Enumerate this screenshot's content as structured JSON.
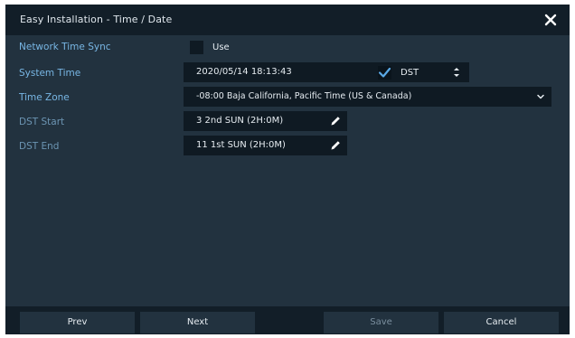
{
  "window": {
    "title": "Easy Installation - Time / Date"
  },
  "fields": {
    "network_time_sync": {
      "label": "Network Time Sync",
      "checkbox_label": "Use",
      "checked": false
    },
    "system_time": {
      "label": "System Time",
      "value": "2020/05/14 18:13:43",
      "dst_label": "DST",
      "dst_checked": true
    },
    "time_zone": {
      "label": "Time Zone",
      "value": "-08:00 Baja California, Pacific Time (US & Canada)"
    },
    "dst_start": {
      "label": "DST Start",
      "value": "3 2nd SUN (2H:0M)"
    },
    "dst_end": {
      "label": "DST End",
      "value": "11 1st SUN (2H:0M)"
    }
  },
  "footer": {
    "prev_label": "Prev",
    "next_label": "Next",
    "save_label": "Save",
    "cancel_label": "Cancel"
  },
  "icons": {
    "close": "close-icon",
    "check": "check-icon",
    "spinner": "spinner-arrows-icon",
    "dropdown": "chevron-down-icon",
    "edit": "pencil-icon"
  },
  "colors": {
    "background": "#22323f",
    "titlebar": "#121e28",
    "field": "#0f1a23",
    "label": "#78b6e4",
    "check_accent": "#5aa9e6"
  }
}
